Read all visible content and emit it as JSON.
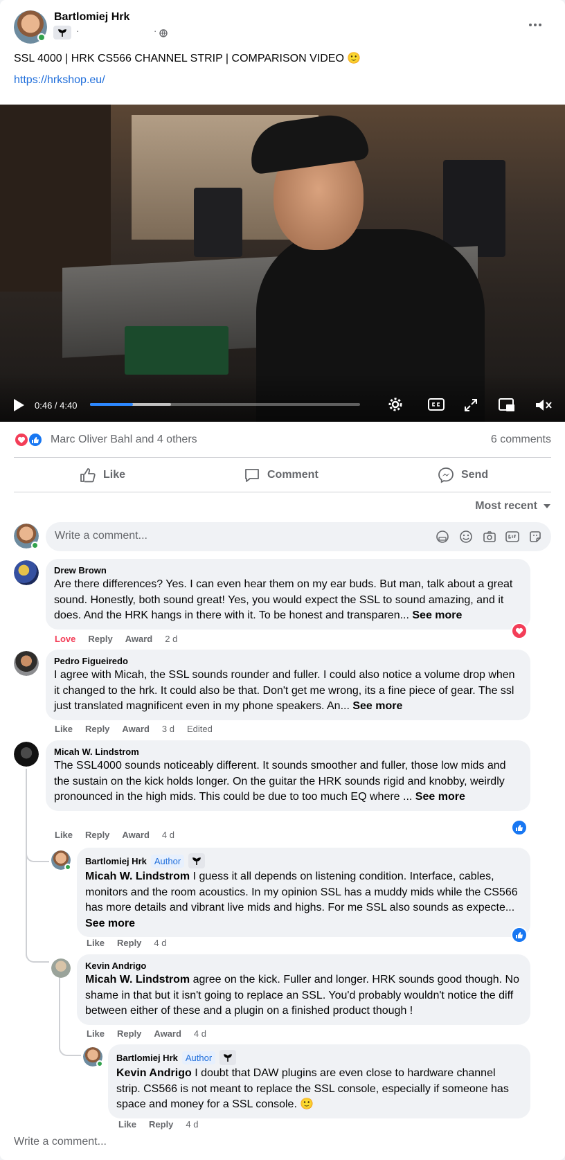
{
  "post": {
    "author": "Bartlomiej Hrk",
    "meta_separator": "·",
    "text": "SSL 4000 | HRK CS566 CHANNEL STRIP | COMPARISON VIDEO 🙂",
    "link": "https://hrkshop.eu/"
  },
  "video": {
    "time": "0:46 / 4:40",
    "progress": 0.16,
    "buffered": 0.3
  },
  "reactions": {
    "summary": "Marc Oliver Bahl and 4 others",
    "comments_count": "6 comments",
    "types": [
      "love",
      "like"
    ]
  },
  "actions": {
    "like": "Like",
    "comment": "Comment",
    "send": "Send"
  },
  "sort": {
    "label": "Most recent"
  },
  "composer": {
    "placeholder": "Write a comment..."
  },
  "comments": [
    {
      "name": "Drew Brown",
      "text": "Are there differences? Yes. I can even hear them on my ear buds. But man, talk about a great sound. Honestly, both sound great! Yes, you would expect the SSL to sound amazing, and it does. And the HRK hangs in there with it. To be honest and transparen...",
      "see_more": "See more",
      "reaction_label": "Love",
      "reply": "Reply",
      "award": "Award",
      "time": "2 d"
    },
    {
      "name": "Pedro Figueiredo",
      "text": "I agree with Micah, the SSL sounds rounder and fuller. I could also notice a volume drop when it changed to the hrk. It could also be that. Don't get me wrong, its a fine piece of gear. The ssl just translated magnificent even in my phone speakers. An...",
      "see_more": "See more",
      "like": "Like",
      "reply": "Reply",
      "award": "Award",
      "time": "3 d",
      "edited": "Edited"
    },
    {
      "name": "Micah W. Lindstrom",
      "text": "The SSL4000 sounds noticeably different. It sounds smoother and fuller, those low mids and the sustain on the kick holds longer. On the guitar the HRK sounds rigid and knobby, weirdly pronounced in the high mids. This could be due to too much EQ where ...",
      "see_more": "See more",
      "like": "Like",
      "reply": "Reply",
      "award": "Award",
      "time": "4 d"
    }
  ],
  "replies": [
    {
      "name": "Bartlomiej Hrk",
      "badge": "Author",
      "mention": "Micah W. Lindstrom",
      "text": " I guess it all depends on listening condition. Interface, cables, monitors and the room acoustics. In my opinion SSL has a muddy mids while the CS566 has more details and vibrant live mids and highs. For me SSL also sounds as expecte...",
      "see_more": "See more",
      "like": "Like",
      "reply": "Reply",
      "time": "4 d"
    },
    {
      "name": "Kevin Andrigo",
      "mention": "Micah W. Lindstrom",
      "text": " agree on the kick. Fuller and longer. HRK sounds good though. No shame in that but it isn't going to replace an SSL. You'd probably wouldn't notice the diff between either of these and a plugin on a finished product though !",
      "like": "Like",
      "reply": "Reply",
      "award": "Award",
      "time": "4 d"
    },
    {
      "name": "Bartlomiej Hrk",
      "badge": "Author",
      "mention": "Kevin Andrigo",
      "text": " I doubt that DAW plugins are even close to hardware channel strip. CS566 is not meant to replace the SSL console, especially if someone has space and money for a SSL console. 🙂",
      "like": "Like",
      "reply": "Reply",
      "time": "4 d"
    }
  ],
  "bottom_composer": {
    "placeholder": "Write a comment..."
  },
  "colors": {
    "accent": "#216fdb",
    "love": "#f33e58",
    "like": "#1877f2"
  }
}
